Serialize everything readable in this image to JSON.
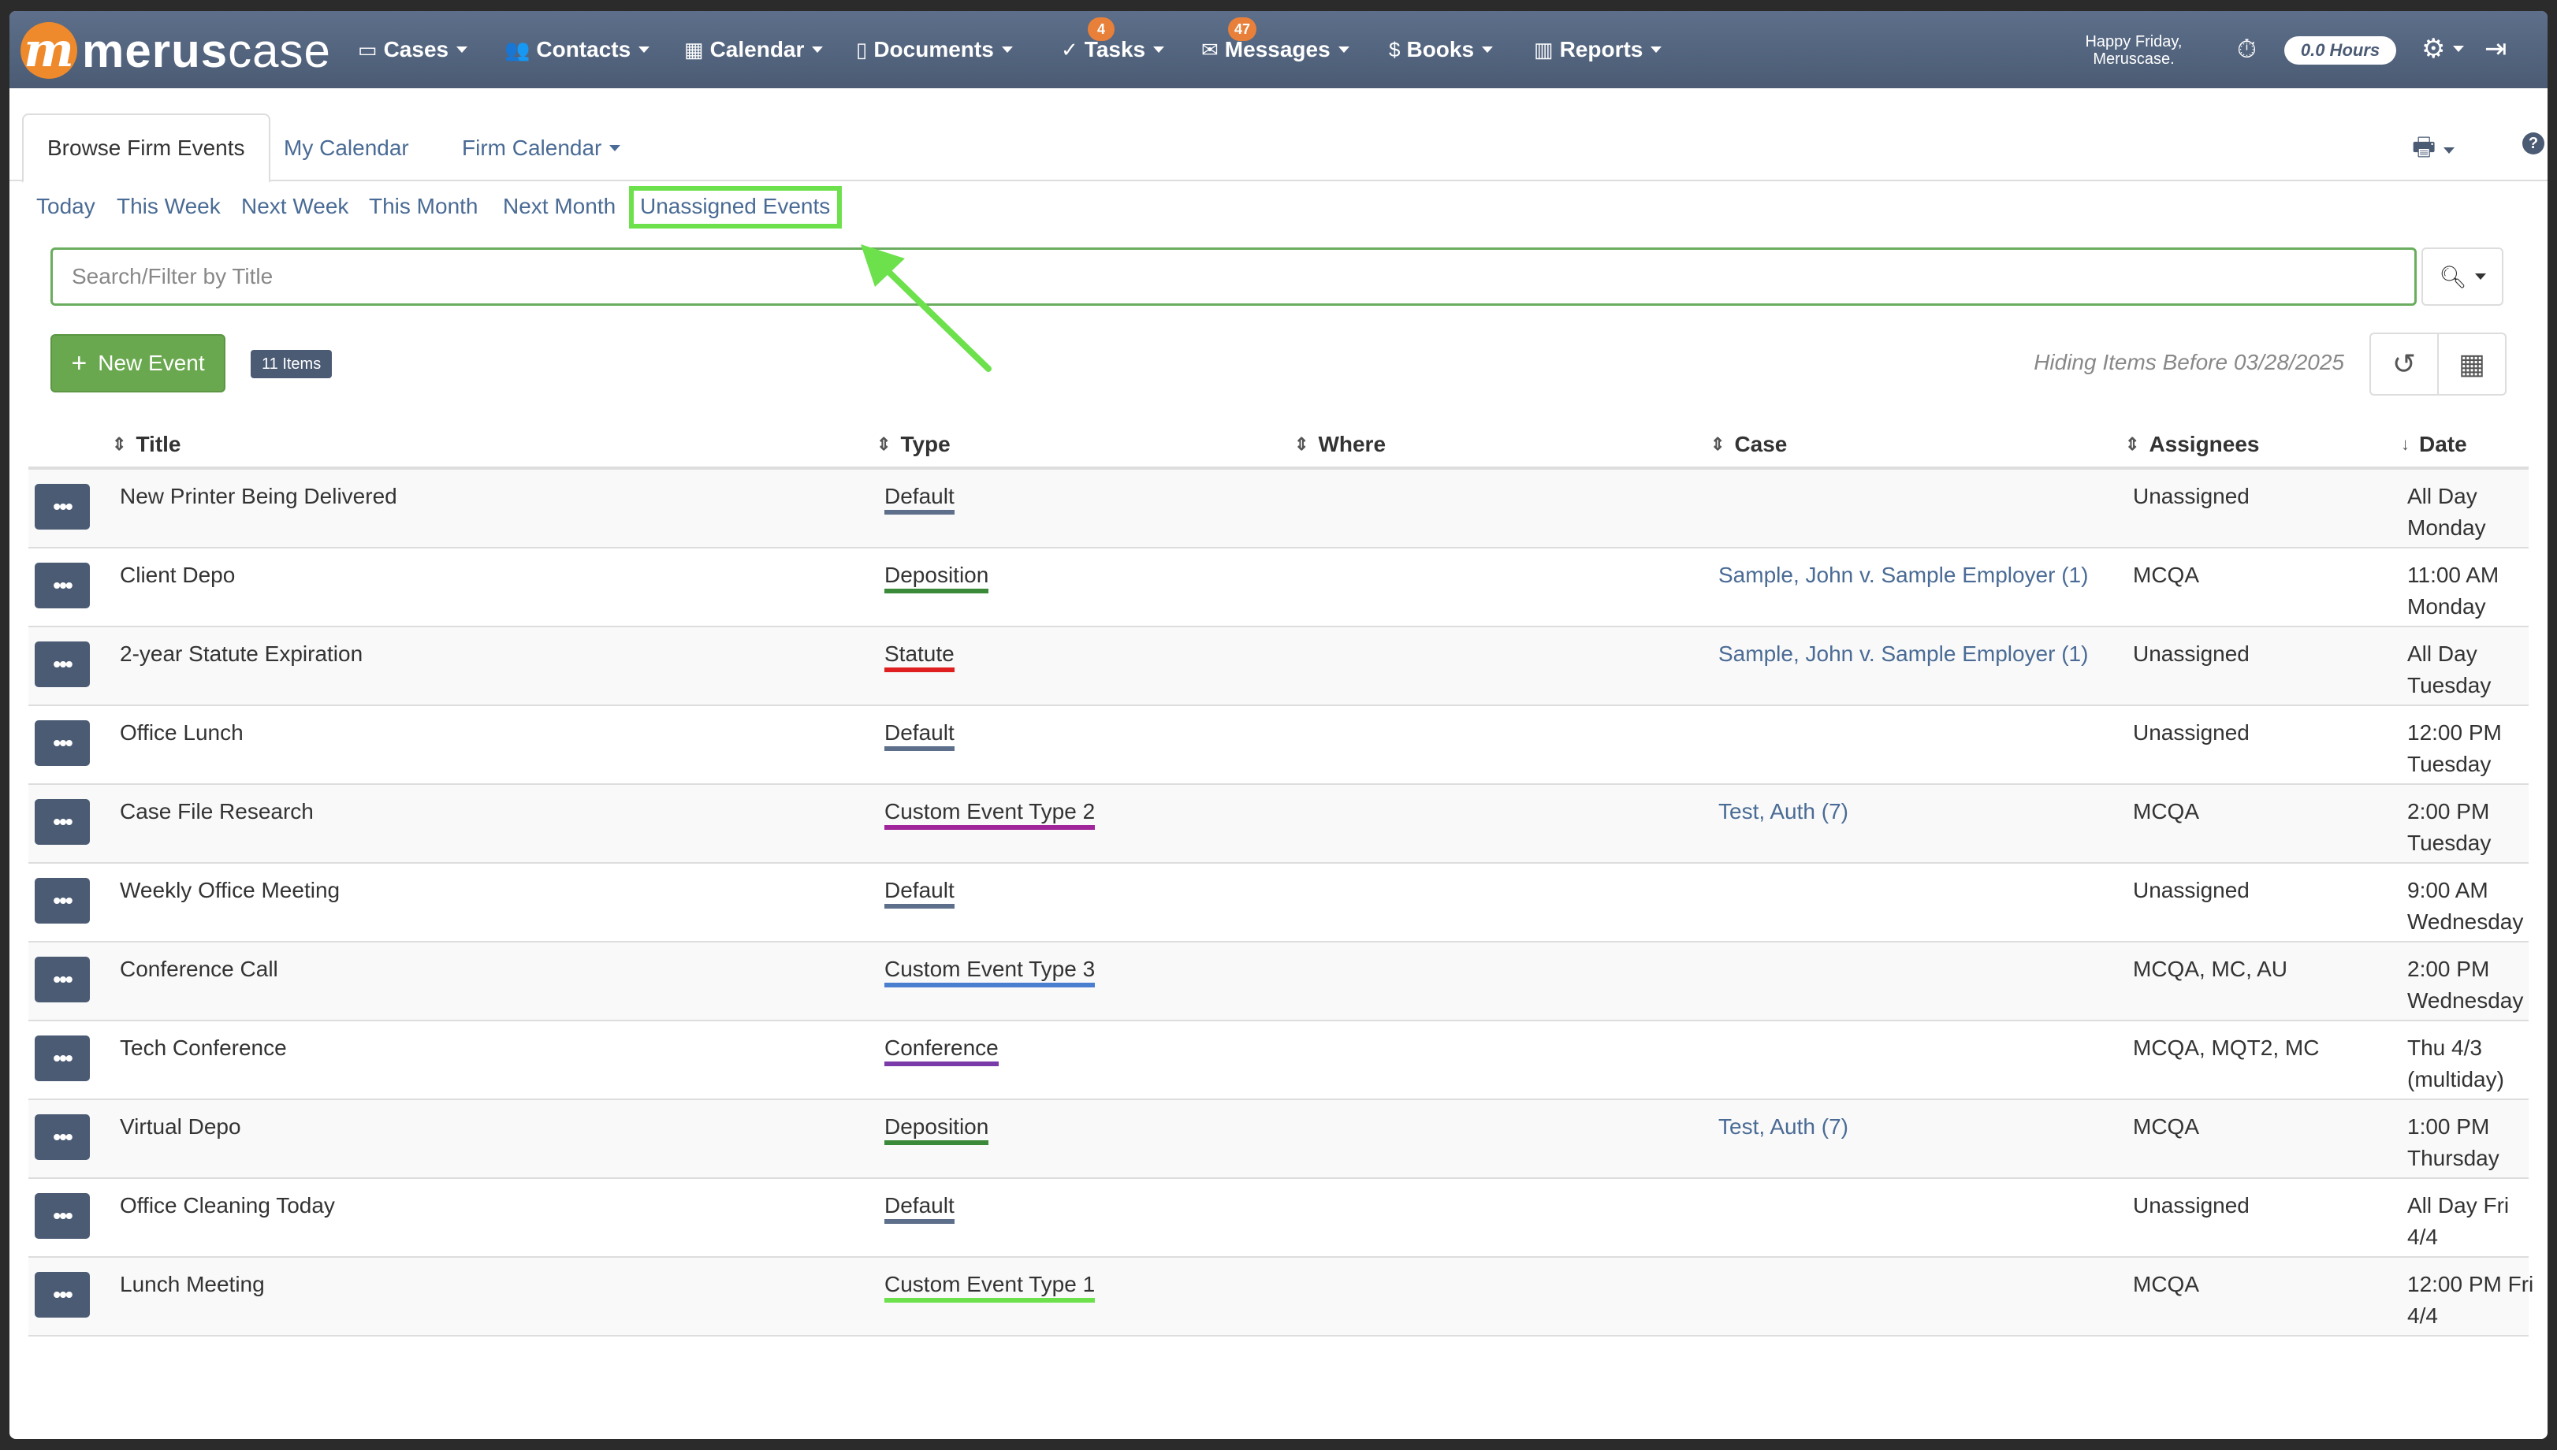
{
  "nav": {
    "logo_bold": "merus",
    "logo_light": "case",
    "items": [
      {
        "label": "Cases",
        "icon": "folder-icon"
      },
      {
        "label": "Contacts",
        "icon": "users-icon"
      },
      {
        "label": "Calendar",
        "icon": "calendar-icon"
      },
      {
        "label": "Documents",
        "icon": "document-icon"
      },
      {
        "label": "Tasks",
        "icon": "check-circle-icon",
        "badge": "4"
      },
      {
        "label": "Messages",
        "icon": "envelope-icon",
        "badge": "47"
      },
      {
        "label": "Books",
        "icon": "dollar-icon"
      },
      {
        "label": "Reports",
        "icon": "bar-chart-icon"
      }
    ],
    "greeting_line1": "Happy Friday,",
    "greeting_line2": "Meruscase.",
    "hours": "0.0 Hours"
  },
  "tabs": {
    "browse": "Browse Firm Events",
    "my_calendar": "My Calendar",
    "firm_calendar": "Firm Calendar"
  },
  "filters": [
    "Today",
    "This Week",
    "Next Week",
    "This Month",
    "Next Month",
    "Unassigned Events"
  ],
  "search": {
    "placeholder": "Search/Filter by Title"
  },
  "toolbar": {
    "new_event": "New Event",
    "items_count": "11 Items",
    "hiding_text": "Hiding Items Before 03/28/2025"
  },
  "columns": {
    "title": "Title",
    "type": "Type",
    "where": "Where",
    "case": "Case",
    "assignees": "Assignees",
    "date": "Date"
  },
  "type_colors": {
    "Default": "#5d6f8a",
    "Deposition": "#3a8a3a",
    "Statute": "#e02020",
    "Custom Event Type 2": "#a0259a",
    "Custom Event Type 3": "#4a7fd0",
    "Conference": "#7a3aa8",
    "Custom Event Type 1": "#6ce14c"
  },
  "rows": [
    {
      "title": "New Printer Being Delivered",
      "type": "Default",
      "case": "",
      "assignees": "Unassigned",
      "date1": "All Day",
      "date2": "Monday"
    },
    {
      "title": "Client Depo",
      "type": "Deposition",
      "case": "Sample, John v. Sample Employer (1)",
      "assignees": "MCQA",
      "date1": "11:00 AM",
      "date2": "Monday"
    },
    {
      "title": "2-year Statute Expiration",
      "type": "Statute",
      "case": "Sample, John v. Sample Employer (1)",
      "assignees": "Unassigned",
      "date1": "All Day",
      "date2": "Tuesday"
    },
    {
      "title": "Office Lunch",
      "type": "Default",
      "case": "",
      "assignees": "Unassigned",
      "date1": "12:00 PM",
      "date2": "Tuesday"
    },
    {
      "title": "Case File Research",
      "type": "Custom Event Type 2",
      "case": "Test, Auth (7)",
      "assignees": "MCQA",
      "date1": "2:00 PM",
      "date2": "Tuesday"
    },
    {
      "title": "Weekly Office Meeting",
      "type": "Default",
      "case": "",
      "assignees": "Unassigned",
      "date1": "9:00 AM",
      "date2": "Wednesday"
    },
    {
      "title": "Conference Call",
      "type": "Custom Event Type 3",
      "case": "",
      "assignees": "MCQA, MC, AU",
      "date1": "2:00 PM",
      "date2": "Wednesday"
    },
    {
      "title": "Tech Conference",
      "type": "Conference",
      "case": "",
      "assignees": "MCQA, MQT2, MC",
      "date1": "Thu 4/3",
      "date2": "(multiday)"
    },
    {
      "title": "Virtual Depo",
      "type": "Deposition",
      "case": "Test, Auth (7)",
      "assignees": "MCQA",
      "date1": "1:00 PM",
      "date2": "Thursday"
    },
    {
      "title": "Office Cleaning Today",
      "type": "Default",
      "case": "",
      "assignees": "Unassigned",
      "date1": "All Day Fri",
      "date2": "4/4"
    },
    {
      "title": "Lunch Meeting",
      "type": "Custom Event Type 1",
      "case": "",
      "assignees": "MCQA",
      "date1": "12:00 PM Fri",
      "date2": "4/4"
    }
  ]
}
